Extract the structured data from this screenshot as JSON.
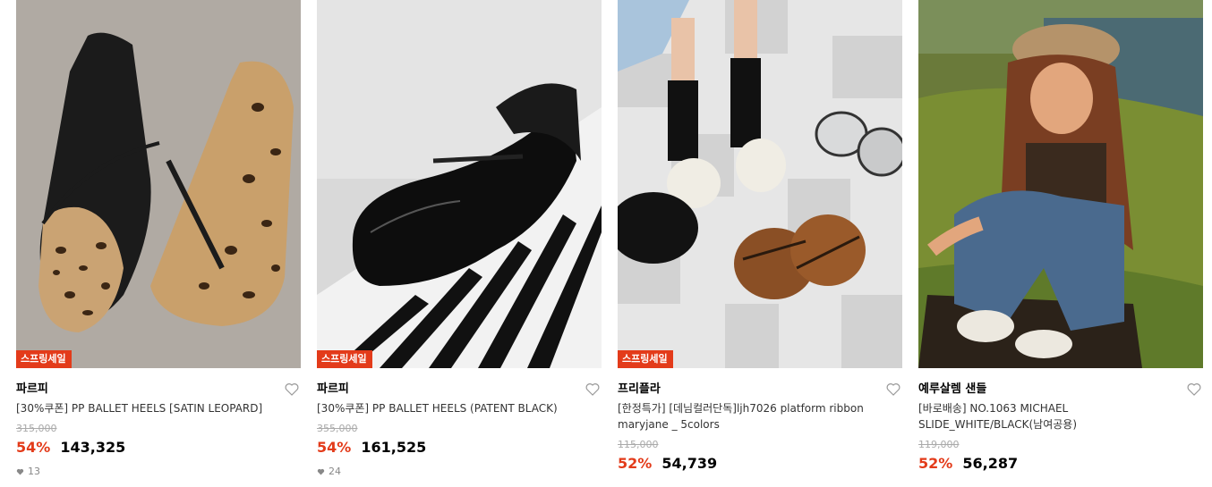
{
  "products": [
    {
      "badge": "스프링세일",
      "brand": "파르피",
      "name": "[30%쿠폰] PP BALLET HEELS [SATIN LEOPARD]",
      "original_price": "315,000",
      "discount": "54%",
      "price": "143,325",
      "likes": "13",
      "image": "leopard-mule-photo"
    },
    {
      "badge": "스프링세일",
      "brand": "파르피",
      "name": "[30%쿠폰] PP BALLET HEELS (PATENT BLACK)",
      "original_price": "355,000",
      "discount": "54%",
      "price": "161,525",
      "likes": "24",
      "image": "black-patent-mule-photo"
    },
    {
      "badge": "스프링세일",
      "brand": "프리플라",
      "name": "[한정특가] [데님컬러단독]ljh7026 platform ribbon maryjane _ 5colors",
      "original_price": "115,000",
      "discount": "52%",
      "price": "54,739",
      "image": "platform-maryjane-photo"
    },
    {
      "brand": "예루살렘 샌들",
      "name": "[바로배송] NO.1063 MICHAEL SLIDE_WHITE/BLACK(남여공용)",
      "original_price": "119,000",
      "discount": "52%",
      "price": "56,287",
      "image": "model-sandal-photo"
    }
  ],
  "colors": {
    "accent": "#e33b1a",
    "text": "#111111",
    "muted": "#aaaaaa"
  },
  "icons": {
    "wishlist": "heart-outline-icon",
    "likes": "heart-filled-icon"
  }
}
